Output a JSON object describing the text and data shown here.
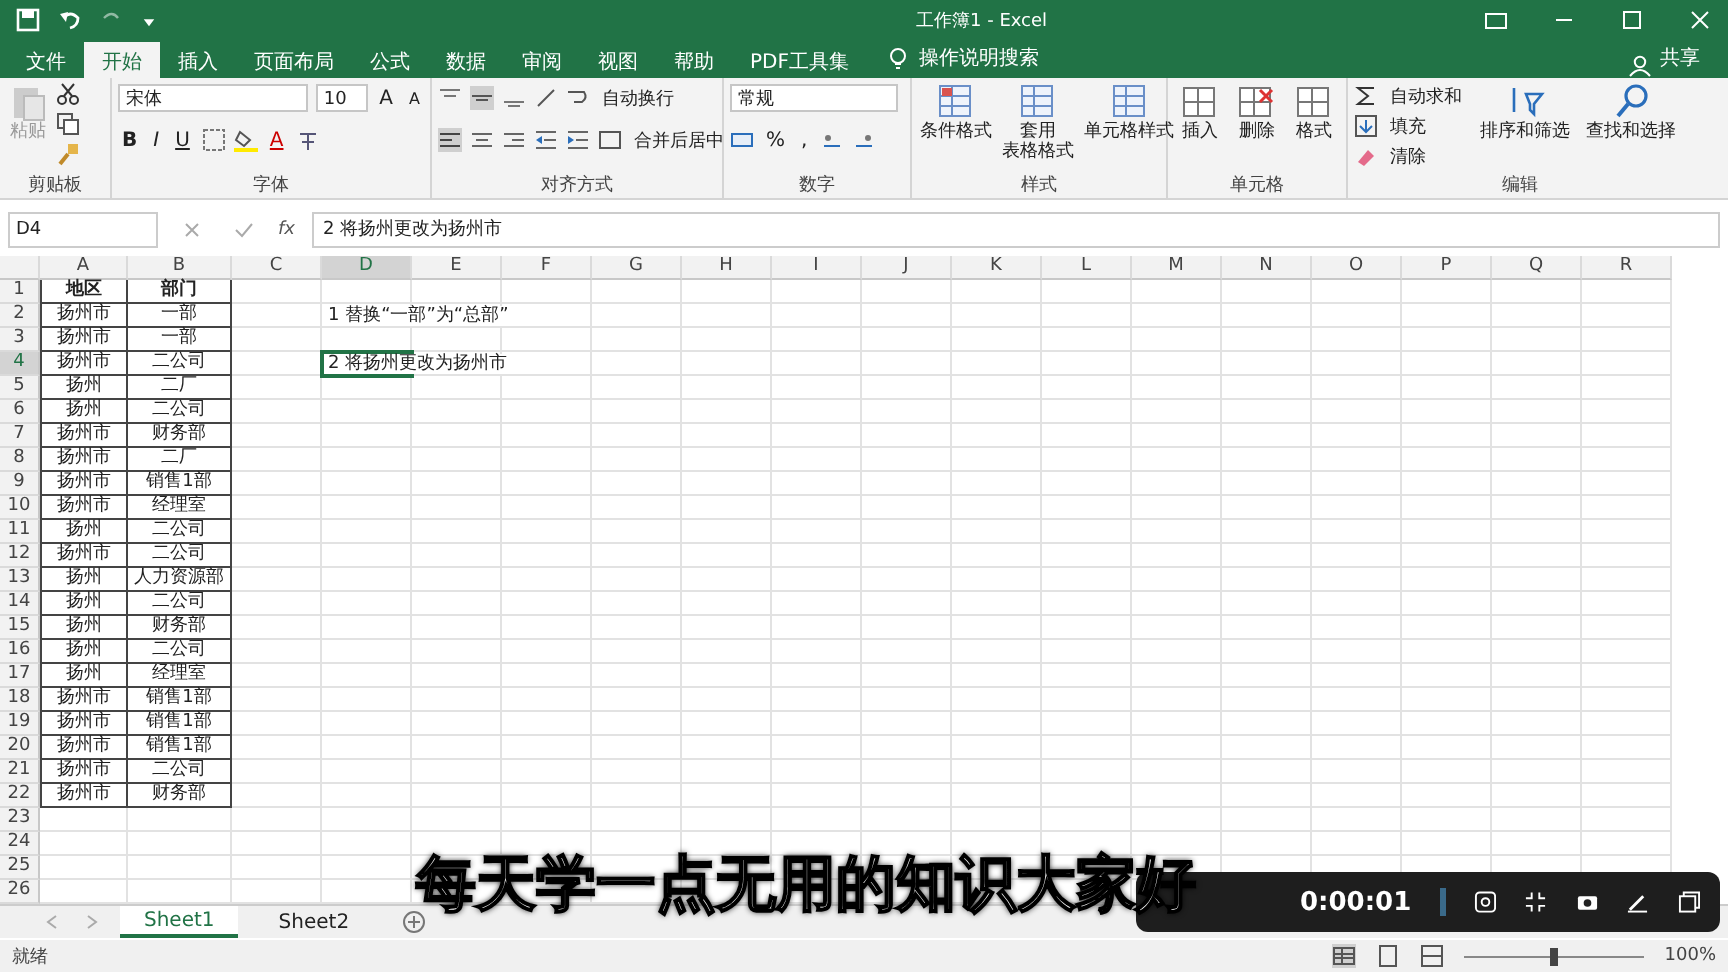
{
  "title_bar": {
    "title": "工作簿1 - Excel"
  },
  "ribbon_tabs": [
    {
      "label": "文件",
      "selected": false
    },
    {
      "label": "开始",
      "selected": true
    },
    {
      "label": "插入",
      "selected": false
    },
    {
      "label": "页面布局",
      "selected": false
    },
    {
      "label": "公式",
      "selected": false
    },
    {
      "label": "数据",
      "selected": false
    },
    {
      "label": "审阅",
      "selected": false
    },
    {
      "label": "视图",
      "selected": false
    },
    {
      "label": "帮助",
      "selected": false
    },
    {
      "label": "PDF工具集",
      "selected": false
    }
  ],
  "tell_me": "操作说明搜索",
  "share": "共享",
  "ribbon": {
    "clipboard": {
      "paste": "粘贴",
      "paste_disabled": true,
      "label": "剪贴板"
    },
    "font": {
      "name": "宋体",
      "size": "10",
      "bold": "B",
      "italic": "I",
      "underline": "U",
      "grow": "A",
      "shrink": "A",
      "font_color_letter": "A",
      "label": "字体"
    },
    "alignment": {
      "wrap": "自动换行",
      "merge": "合并后居中",
      "label": "对齐方式"
    },
    "number": {
      "format": "常规",
      "percent": "%",
      "comma": ",",
      "label": "数字"
    },
    "styles": {
      "buttons": [
        {
          "label": "条件格式"
        },
        {
          "label": "套用",
          "label_2": "表格格式"
        },
        {
          "label": "单元格样式"
        }
      ],
      "label": "样式"
    },
    "cells": {
      "buttons": [
        {
          "label": "插入"
        },
        {
          "label": "删除"
        },
        {
          "label": "格式"
        }
      ],
      "label": "单元格"
    },
    "editing": {
      "autosum": "自动求和",
      "fill": "填充",
      "clear": "清除",
      "sort": "排序和筛选",
      "find": "查找和选择",
      "label": "编辑"
    }
  },
  "formula_bar": {
    "name_box": "D4",
    "function_button": "fx",
    "formula": "2 将扬州更改为扬州市"
  },
  "columns": [
    {
      "label": "A",
      "selected": false
    },
    {
      "label": "B",
      "selected": false
    },
    {
      "label": "C",
      "selected": false
    },
    {
      "label": "D",
      "selected": true
    },
    {
      "label": "E",
      "selected": false
    },
    {
      "label": "F",
      "selected": false
    },
    {
      "label": "G",
      "selected": false
    },
    {
      "label": "H",
      "selected": false
    },
    {
      "label": "I",
      "selected": false
    },
    {
      "label": "J",
      "selected": false
    },
    {
      "label": "K",
      "selected": false
    },
    {
      "label": "L",
      "selected": false
    },
    {
      "label": "M",
      "selected": false
    },
    {
      "label": "N",
      "selected": false
    },
    {
      "label": "O",
      "selected": false
    },
    {
      "label": "P",
      "selected": false
    },
    {
      "label": "Q",
      "selected": false
    },
    {
      "label": "R",
      "selected": false
    }
  ],
  "rows": [
    {
      "number": "1",
      "kind": "header",
      "a": "地区",
      "b": "部门",
      "selected": false
    },
    {
      "number": "2",
      "kind": "data",
      "a": "扬州市",
      "b": "一部",
      "note": "1 替换“一部”为“总部”",
      "selected": false
    },
    {
      "number": "3",
      "kind": "data",
      "a": "扬州市",
      "b": "一部",
      "selected": false
    },
    {
      "number": "4",
      "kind": "data",
      "a": "扬州市",
      "b": "二公司",
      "note": "2 将扬州更改为扬州市",
      "selected": true
    },
    {
      "number": "5",
      "kind": "data",
      "a": "扬州",
      "b": "二厂",
      "selected": false
    },
    {
      "number": "6",
      "kind": "data",
      "a": "扬州",
      "b": "二公司",
      "selected": false
    },
    {
      "number": "7",
      "kind": "data",
      "a": "扬州市",
      "b": "财务部",
      "selected": false
    },
    {
      "number": "8",
      "kind": "data",
      "a": "扬州市",
      "b": "二厂",
      "selected": false
    },
    {
      "number": "9",
      "kind": "data",
      "a": "扬州市",
      "b": "销售1部",
      "selected": false
    },
    {
      "number": "10",
      "kind": "data",
      "a": "扬州市",
      "b": "经理室",
      "selected": false
    },
    {
      "number": "11",
      "kind": "data",
      "a": "扬州",
      "b": "二公司",
      "selected": false
    },
    {
      "number": "12",
      "kind": "data",
      "a": "扬州市",
      "b": "二公司",
      "selected": false
    },
    {
      "number": "13",
      "kind": "data",
      "a": "扬州",
      "b": "人力资源部",
      "selected": false
    },
    {
      "number": "14",
      "kind": "data",
      "a": "扬州",
      "b": "二公司",
      "selected": false
    },
    {
      "number": "15",
      "kind": "data",
      "a": "扬州",
      "b": "财务部",
      "selected": false
    },
    {
      "number": "16",
      "kind": "data",
      "a": "扬州",
      "b": "二公司",
      "selected": false
    },
    {
      "number": "17",
      "kind": "data",
      "a": "扬州",
      "b": "经理室",
      "selected": false
    },
    {
      "number": "18",
      "kind": "data",
      "a": "扬州市",
      "b": "销售1部",
      "selected": false
    },
    {
      "number": "19",
      "kind": "data",
      "a": "扬州市",
      "b": "销售1部",
      "selected": false
    },
    {
      "number": "20",
      "kind": "data",
      "a": "扬州市",
      "b": "销售1部",
      "selected": false
    },
    {
      "number": "21",
      "kind": "data",
      "a": "扬州市",
      "b": "二公司",
      "selected": false
    },
    {
      "number": "22",
      "kind": "data",
      "a": "扬州市",
      "b": "财务部",
      "selected": false
    },
    {
      "number": "23",
      "kind": "blank",
      "selected": false
    },
    {
      "number": "24",
      "kind": "blank",
      "selected": false
    },
    {
      "number": "25",
      "kind": "blank",
      "selected": false
    },
    {
      "number": "26",
      "kind": "blank",
      "selected": false
    }
  ],
  "sheet_tabs": [
    {
      "label": "Sheet1",
      "selected": true
    },
    {
      "label": "Sheet2",
      "selected": false
    }
  ],
  "status_bar": {
    "status": "就绪",
    "zoom": {
      "reading": "100%",
      "level": 0.5
    }
  },
  "recorder": {
    "time": "0:00:01"
  },
  "caption": "每天学一点无用的知识大家好"
}
